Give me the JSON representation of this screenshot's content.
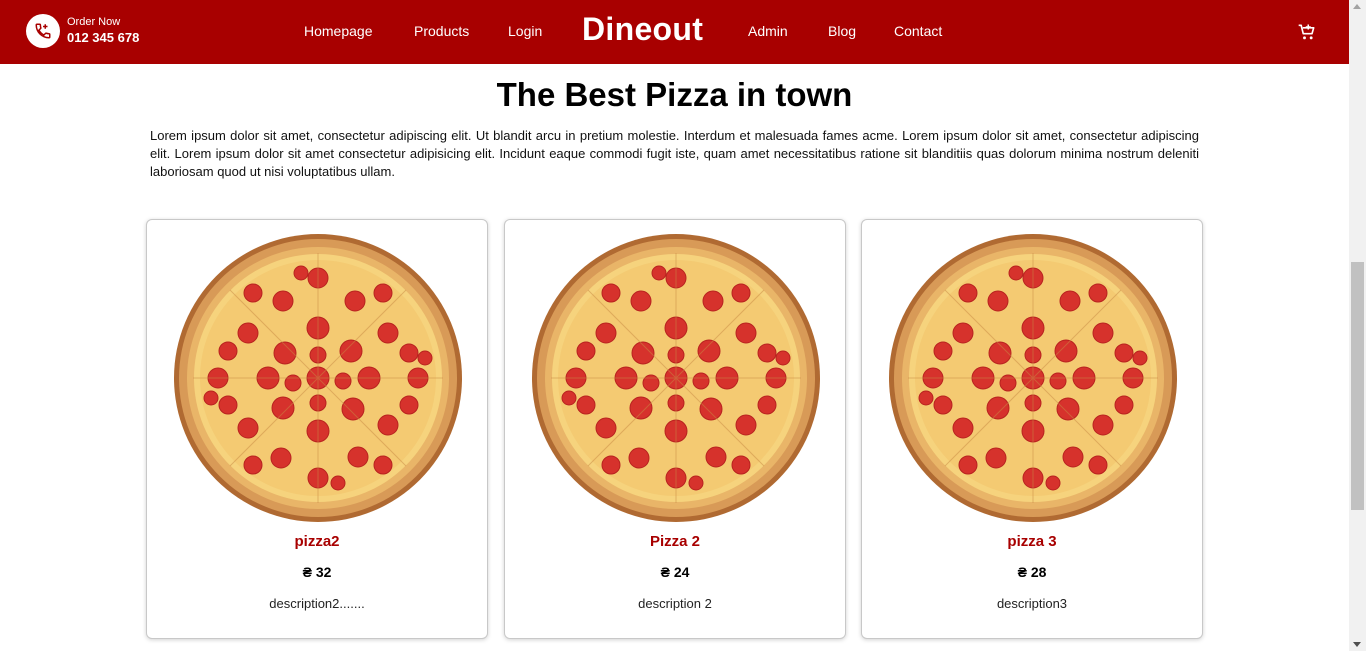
{
  "header": {
    "order_label": "Order Now",
    "order_number": "012 345 678",
    "logo": "Dineout",
    "nav_left": [
      "Homepage",
      "Products",
      "Login"
    ],
    "nav_right": [
      "Admin",
      "Blog",
      "Contact"
    ],
    "phone_icon": "phone-icon",
    "cart_icon": "cart-icon",
    "bg_color": "#a80000"
  },
  "main": {
    "title": "The Best Pizza in town",
    "intro": "Lorem ipsum dolor sit amet, consectetur adipiscing elit. Ut blandit arcu in pretium molestie. Interdum et malesuada fames acme. Lorem ipsum dolor sit amet, consectetur adipiscing elit. Lorem ipsum dolor sit amet consectetur adipisicing elit. Incidunt eaque commodi fugit iste, quam amet necessitatibus ratione sit blanditiis quas dolorum minima nostrum deleniti laboriosam quod ut nisi voluptatibus ullam."
  },
  "products": [
    {
      "name": "pizza2",
      "price": "₴ 32",
      "description": "description2......."
    },
    {
      "name": "Pizza 2",
      "price": "₴ 24",
      "description": "description 2"
    },
    {
      "name": "pizza 3",
      "price": "₴ 28",
      "description": "description3"
    }
  ]
}
